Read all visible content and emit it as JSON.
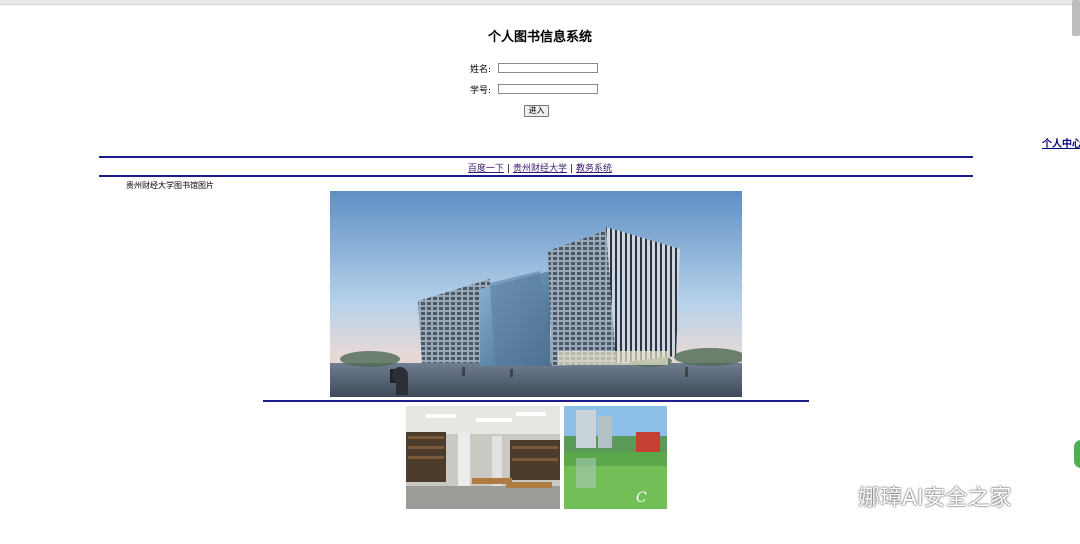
{
  "header": {
    "title": "个人图书信息系统"
  },
  "form": {
    "name_label": "姓名:",
    "name_value": "",
    "id_label": "学号:",
    "id_value": "",
    "submit_label": "进入"
  },
  "right_link": "个人中心",
  "nav": {
    "links": [
      "百度一下",
      "贵州财经大学",
      "教务系统"
    ],
    "separator": "|"
  },
  "caption": "贵州财经大学图书馆图片",
  "watermark": {
    "text": "娜璋AI安全之家",
    "icon": "wechat-icon"
  },
  "colors": {
    "rule": "#1c1c8c",
    "link": "#3a1a6e",
    "right_link": "#000080"
  }
}
